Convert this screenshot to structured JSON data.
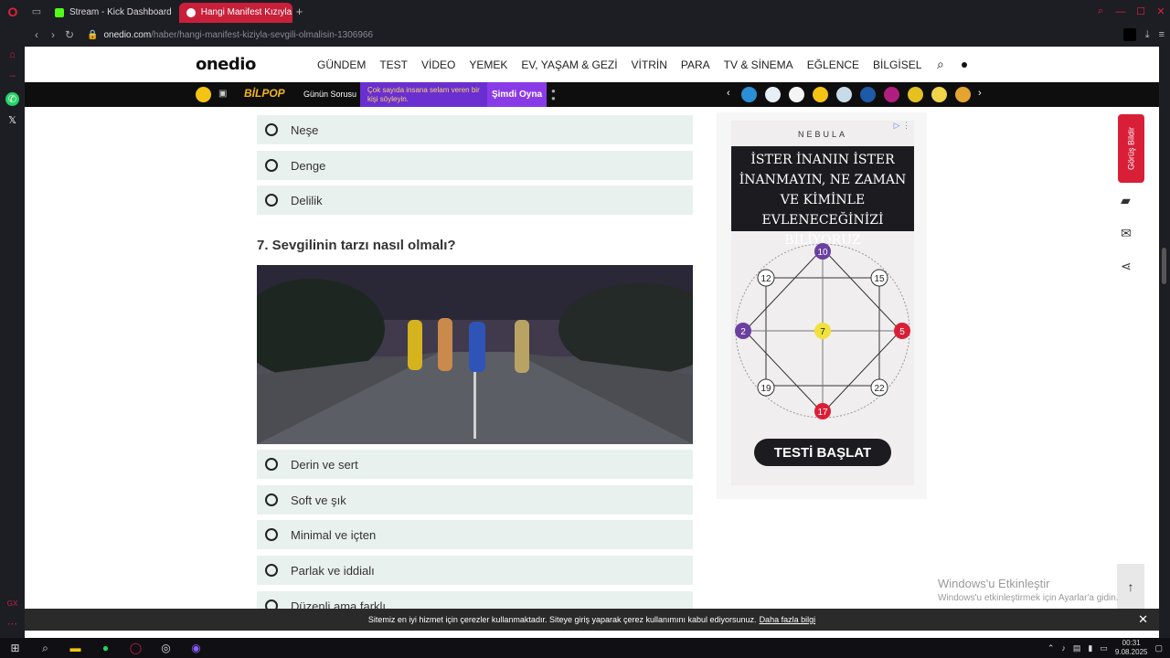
{
  "browser": {
    "tabs": [
      {
        "label": "Stream - Kick Dashboard",
        "active": false
      },
      {
        "label": "Hangi Manifest Kızıyla Se",
        "active": true
      }
    ],
    "new_tab": "+",
    "url_host": "onedio.com",
    "url_path": "/haber/hangi-manifest-kiziyla-sevgili-olmalisin-1306966"
  },
  "site": {
    "logo": "onedio",
    "menu": [
      "GÜNDEM",
      "TEST",
      "VİDEO",
      "YEMEK",
      "EV, YAŞAM & GEZİ",
      "VİTRİN",
      "PARA",
      "TV & SİNEMA",
      "EĞLENCE",
      "BİLGİSEL"
    ]
  },
  "subbar": {
    "bilpop": "BİLPOP",
    "gunun_sorusu": "Günün Sorusu",
    "question": "Çok sayıda insana selam veren bir kişi söyleyin.",
    "play": "Şimdi Oyna"
  },
  "quiz": {
    "prev_options": [
      "Neşe",
      "Denge",
      "Delilik"
    ],
    "question_title": "7. Sevgilinin tarzı nasıl olmalı?",
    "options": [
      "Derin ve sert",
      "Soft ve şık",
      "Minimal ve içten",
      "Parlak ve iddialı",
      "Düzenli ama farklı"
    ]
  },
  "ad": {
    "brand": "NEBULA",
    "headline": "İSTER İNANIN İSTER İNANMAYIN, NE ZAMAN VE KİMİNLE EVLENECEĞİNİZİ BİLİYORUZ",
    "cta": "TESTİ BAŞLAT",
    "numbers": [
      "10",
      "12",
      "15",
      "2",
      "7",
      "5",
      "19",
      "22",
      "17"
    ]
  },
  "float": {
    "feedback": "Görüş Bildir"
  },
  "watermark": {
    "line1": "Windows'u Etkinleştir",
    "line2": "Windows'u etkinleştirmek için Ayarlar'a gidin."
  },
  "cookie": {
    "text": "Sitemiz en iyi hizmet için çerezler kullanmaktadır. Siteye giriş yaparak çerez kullanımını kabul ediyorsunuz.",
    "more": "Daha fazla bilgi"
  },
  "taskbar": {
    "time": "00:31",
    "date": "9.08.2025"
  },
  "colors": {
    "brand_red": "#d91f37",
    "option_bg": "#e9f1ee",
    "bilpop_purple": "#6a2fd0"
  }
}
